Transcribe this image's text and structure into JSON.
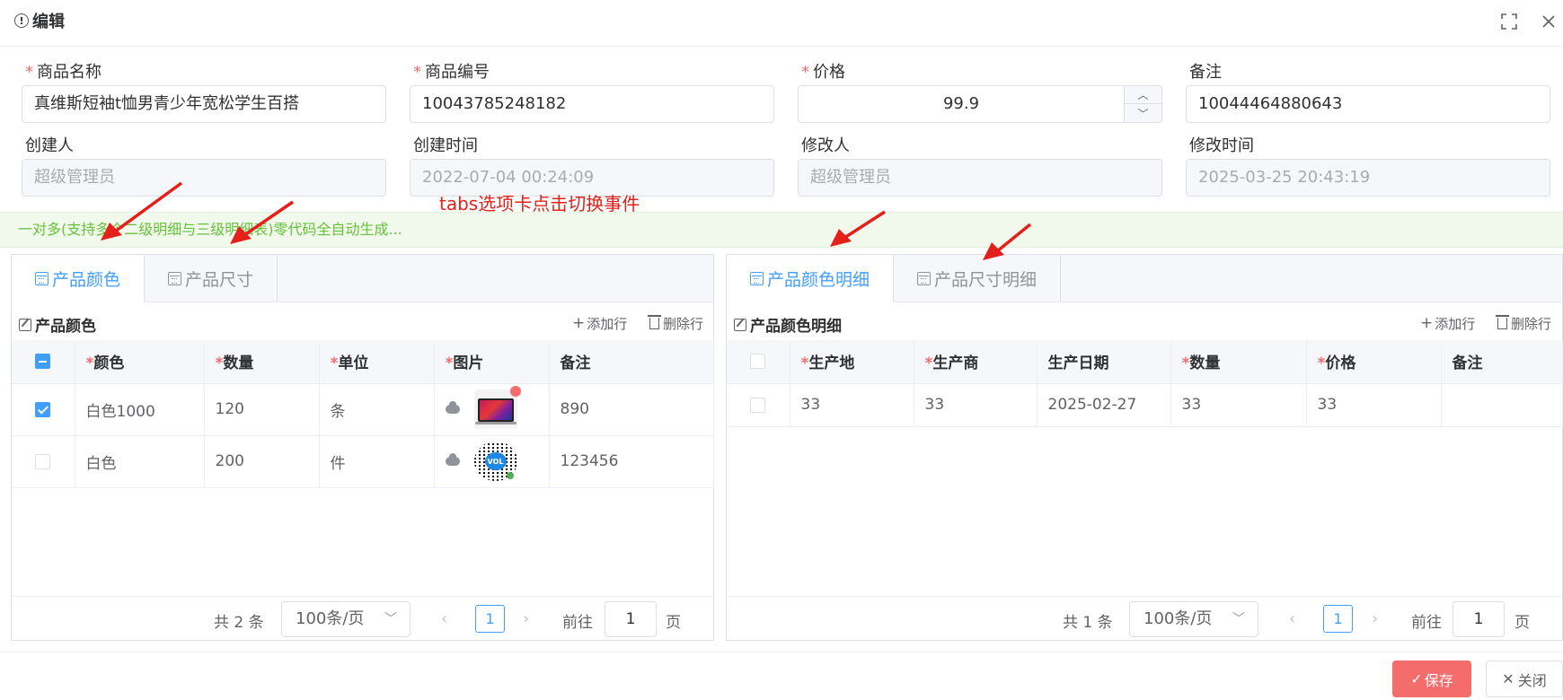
{
  "dialog": {
    "title": "编辑"
  },
  "form": {
    "name_label": "商品名称",
    "name_value": "真维斯短袖t恤男青少年宽松学生百搭",
    "code_label": "商品编号",
    "code_value": "10043785248182",
    "price_label": "价格",
    "price_value": "99.9",
    "remark_label": "备注",
    "remark_value": "10044464880643",
    "creator_label": "创建人",
    "creator_value": "超级管理员",
    "created_label": "创建时间",
    "created_value": "2022-07-04 00:24:09",
    "modifier_label": "修改人",
    "modifier_value": "超级管理员",
    "modified_label": "修改时间",
    "modified_value": "2025-03-25 20:43:19"
  },
  "annotation": "tabs选项卡点击切换事件",
  "banner": "一对多(支持多个二级明细与三级明细表)零代码全自动生成...",
  "left_panel": {
    "tabs": [
      "产品颜色",
      "产品尺寸"
    ],
    "toolbar_title": "产品颜色",
    "add_row": "添加行",
    "delete_row": "删除行",
    "columns": [
      "颜色",
      "数量",
      "单位",
      "图片",
      "备注"
    ],
    "rows": [
      {
        "color": "白色1000",
        "qty": "120",
        "unit": "条",
        "remark": "890"
      },
      {
        "color": "白色",
        "qty": "200",
        "unit": "件",
        "remark": "123456"
      }
    ],
    "pager": {
      "total": "共 2 条",
      "page_size": "100条/页",
      "page": "1",
      "goto": "前往",
      "goto_value": "1",
      "page_unit": "页"
    }
  },
  "right_panel": {
    "tabs": [
      "产品颜色明细",
      "产品尺寸明细"
    ],
    "toolbar_title": "产品颜色明细",
    "add_row": "添加行",
    "delete_row": "删除行",
    "columns": [
      "生产地",
      "生产商",
      "生产日期",
      "数量",
      "价格",
      "备注"
    ],
    "rows": [
      {
        "origin": "33",
        "maker": "33",
        "date": "2025-02-27",
        "qty": "33",
        "price": "33",
        "remark": ""
      }
    ],
    "pager": {
      "total": "共 1 条",
      "page_size": "100条/页",
      "page": "1",
      "goto": "前往",
      "goto_value": "1",
      "page_unit": "页"
    }
  },
  "footer": {
    "save": "保存",
    "close": "关闭"
  },
  "colors": {
    "primary": "#409eff",
    "danger": "#f56c6c",
    "success": "#67c23a",
    "annotation": "#e4201a"
  }
}
